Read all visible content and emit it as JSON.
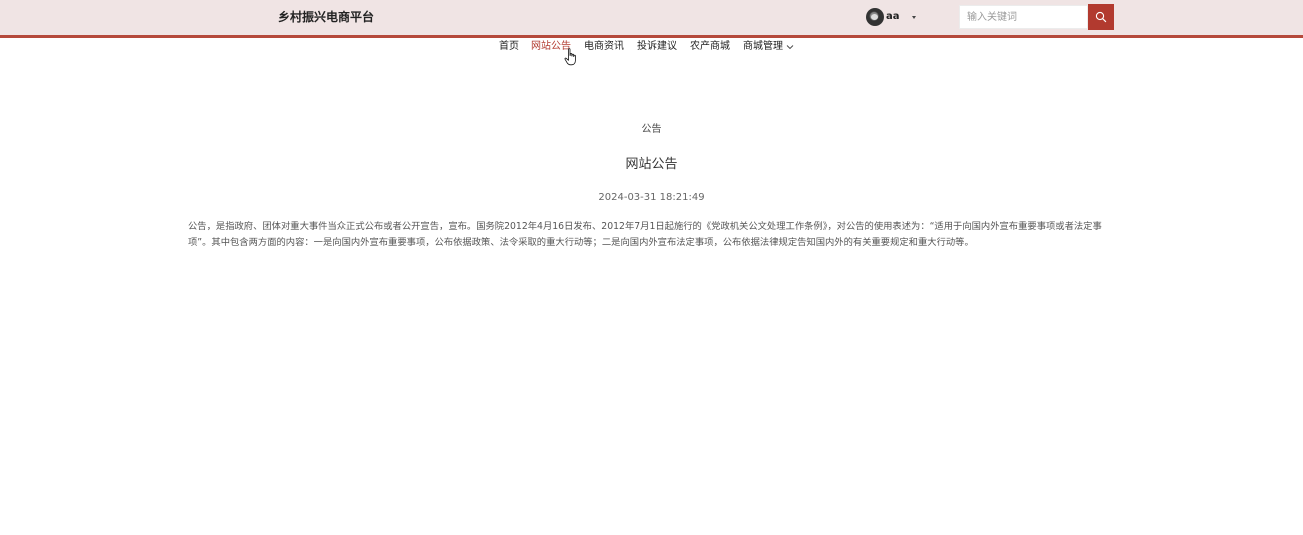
{
  "header": {
    "site_title": "乡村振兴电商平台",
    "username": "aa",
    "search_placeholder": "输入关键词",
    "accent_color": "#b23a2f",
    "background_color": "#f0e4e4"
  },
  "nav": {
    "items": [
      {
        "label": "首页",
        "active": false
      },
      {
        "label": "网站公告",
        "active": true
      },
      {
        "label": "电商资讯",
        "active": false
      },
      {
        "label": "投诉建议",
        "active": false
      },
      {
        "label": "农产商城",
        "active": false
      },
      {
        "label": "商城管理",
        "active": false,
        "has_dropdown": true
      }
    ]
  },
  "article": {
    "category": "公告",
    "title": "网站公告",
    "date": "2024-03-31 18:21:49",
    "body": "公告，是指政府、团体对重大事件当众正式公布或者公开宣告，宣布。国务院2012年4月16日发布、2012年7月1日起施行的《党政机关公文处理工作条例》，对公告的使用表述为：“适用于向国内外宣布重要事项或者法定事项”。其中包含两方面的内容：一是向国内外宣布重要事项，公布依据政策、法令采取的重大行动等；二是向国内外宣布法定事项，公布依据法律规定告知国内外的有关重要规定和重大行动等。"
  },
  "icons": {
    "search": "search-icon",
    "caret": "caret-down-icon",
    "chevron": "chevron-down-icon",
    "avatar": "avatar",
    "cursor": "hand-cursor-icon"
  }
}
